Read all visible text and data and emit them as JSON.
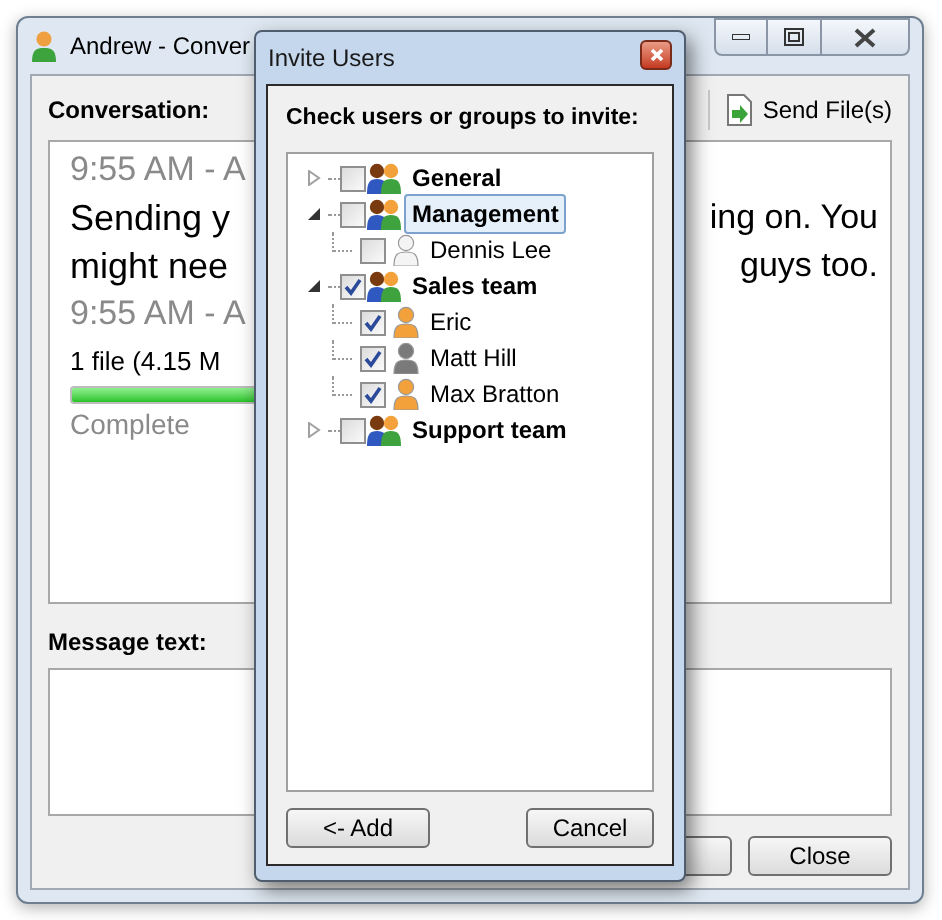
{
  "window": {
    "title": "Andrew - Conver"
  },
  "toolbar": {
    "send_files": "Send File(s)"
  },
  "conversation": {
    "label": "Conversation:",
    "left_lines": [
      {
        "kind": "time",
        "text": "9:55 AM - A"
      },
      {
        "kind": "message",
        "text": "Sending y"
      },
      {
        "kind": "message",
        "text": "might nee"
      },
      {
        "kind": "time",
        "text": "9:55 AM - A"
      },
      {
        "kind": "message",
        "text": "1 file (4.15 M"
      },
      {
        "kind": "progress",
        "level": 1
      },
      {
        "kind": "status",
        "text": "Complete"
      }
    ],
    "right_lines": [
      "ing on. You",
      "guys too."
    ]
  },
  "message": {
    "label": "Message text:"
  },
  "buttons": [
    "Close"
  ],
  "dialog": {
    "title": "Invite Users",
    "prompt": "Check users or groups to invite:",
    "tree": [
      {
        "label": "General",
        "checked": false,
        "expanded": false,
        "selected": false
      },
      {
        "label": "Management",
        "checked": false,
        "expanded": true,
        "selected": true,
        "children": [
          {
            "label": "Dennis Lee",
            "checked": false,
            "color": "#f4f4f4"
          }
        ]
      },
      {
        "label": "Sales team",
        "checked": true,
        "expanded": true,
        "selected": false,
        "children": [
          {
            "label": "Eric",
            "checked": true,
            "color": "#f3a13a"
          },
          {
            "label": "Matt Hill",
            "checked": true,
            "color": "#7a7a7a"
          },
          {
            "label": "Max Bratton",
            "checked": true,
            "color": "#f3a13a"
          }
        ]
      },
      {
        "label": "Support team",
        "checked": false,
        "expanded": false,
        "selected": false
      }
    ],
    "buttons": [
      "<- Add",
      "Cancel"
    ]
  }
}
